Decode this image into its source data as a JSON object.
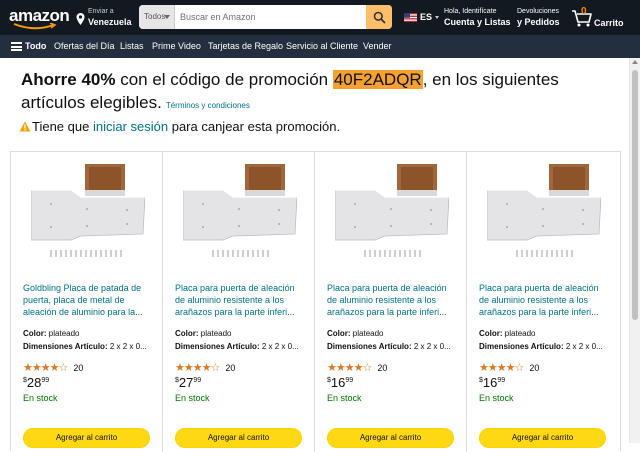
{
  "nav": {
    "logo": "amazon",
    "deliver_line1": "Enviar a",
    "deliver_line2": "Venezuela",
    "search_category": "Todos",
    "search_placeholder": "Buscar en Amazon",
    "language": "ES",
    "account_line1": "Hola, Identifícate",
    "account_line2": "Cuenta y Listas",
    "returns_line1": "Devoluciones",
    "returns_line2": "y Pedidos",
    "cart_count": "0",
    "cart_label": "Carrito",
    "icons": [
      "location-pin-icon",
      "search-icon",
      "us-flag-icon",
      "cart-icon",
      "hamburger-icon"
    ]
  },
  "subnav": {
    "all": "Todo",
    "items": [
      "Ofertas del Día",
      "Listas",
      "Prime Video",
      "Tarjetas de Regalo",
      "Servicio al Cliente",
      "Vender"
    ]
  },
  "promo": {
    "lead_bold": "Ahorre 40%",
    "lead_mid": " con el código de promoción ",
    "code": "40F2ADQR",
    "lead_end": ", en los siguientes artículos elegibles.",
    "terms": "Términos y condiciones",
    "signin_pre": "Tiene que ",
    "signin_link": "iniciar sesión",
    "signin_post": " para canjear esta promoción."
  },
  "products": [
    {
      "title": "Goldbling Placa de patada de puerta, placa de metal de aleación de aluminio para la...",
      "color_label": "Color:",
      "color_value": "plateado",
      "dims_label": "Dimensiones Artículo:",
      "dims_value": "2 x 2 x 0...",
      "stars": "★★★★☆",
      "rating_count": "20",
      "price_symbol": "$",
      "price_whole": "28",
      "price_fraction": "99",
      "stock": "En stock",
      "button": "Agregar al carrito"
    },
    {
      "title": "Placa para puerta de aleación de aluminio resistente a los arañazos para la parte inferi...",
      "color_label": "Color:",
      "color_value": "plateado",
      "dims_label": "Dimensiones Artículo:",
      "dims_value": "2 x 2 x 0...",
      "stars": "★★★★☆",
      "rating_count": "20",
      "price_symbol": "$",
      "price_whole": "27",
      "price_fraction": "99",
      "stock": "En stock",
      "button": "Agregar al carrito"
    },
    {
      "title": "Placa para puerta de aleación de aluminio resistente a los arañazos para la parte inferi...",
      "color_label": "Color:",
      "color_value": "plateado",
      "dims_label": "Dimensiones Artículo:",
      "dims_value": "2 x 2 x 0...",
      "stars": "★★★★☆",
      "rating_count": "20",
      "price_symbol": "$",
      "price_whole": "16",
      "price_fraction": "99",
      "stock": "En stock",
      "button": "Agregar al carrito"
    },
    {
      "title": "Placa para puerta de aleación de aluminio resistente a los arañazos para la parte inferi...",
      "color_label": "Color:",
      "color_value": "plateado",
      "dims_label": "Dimensiones Artículo:",
      "dims_value": "2 x 2 x 0...",
      "stars": "★★★★☆",
      "rating_count": "20",
      "price_symbol": "$",
      "price_whole": "16",
      "price_fraction": "99",
      "stock": "En stock",
      "button": "Agregar al carrito"
    }
  ],
  "colors": {
    "nav_bg": "#131921",
    "subnav_bg": "#232f3e",
    "accent_orange": "#febd69",
    "promo_highlight": "#f6a032",
    "link": "#007185",
    "in_stock": "#007600",
    "button_yellow": "#ffd814",
    "star": "#de7921"
  }
}
